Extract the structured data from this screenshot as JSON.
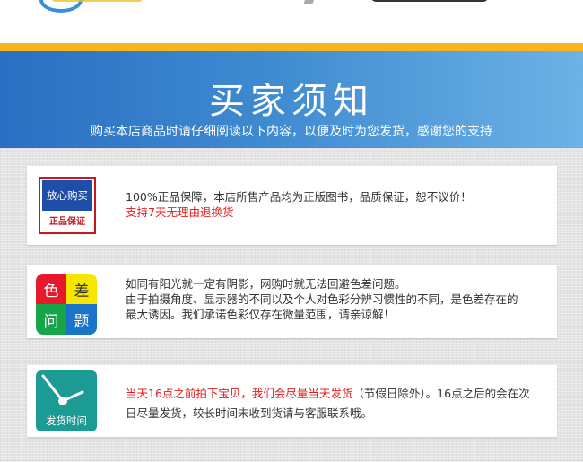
{
  "colors": {
    "accent_orange": "#f6b51c",
    "banner_left": "#2a6fc2",
    "banner_right": "#6cb2e6",
    "red_text": "#e02020",
    "card_bg": "#ffffff",
    "texture_bg": "#e3e3e3"
  },
  "banner": {
    "title": "买家须知",
    "subtitle": "购买本店商品时请仔细阅读以下内容，以便及时为您发货，感谢您的支持"
  },
  "cards": [
    {
      "icon": "guarantee-badge-icon",
      "icon_top_label": "放心购买",
      "icon_bottom_label": "正品保证",
      "line1": "100%正品保障，本店所售产品均为正版图书，品质保证，恕不议价！",
      "line2": "支持7天无理由退换货"
    },
    {
      "icon": "color-difference-icon",
      "icon_chars": [
        "色",
        "差",
        "问",
        "题"
      ],
      "line1": "如同有阳光就一定有阴影，网购时就无法回避色差问题。",
      "line2": "由于拍摄角度、显示器的不同以及个人对色彩分辨习惯性的不同，是色差存在的",
      "line3": "最大诱因。我们承诺色彩仅存在微量范围，请亲谅解！"
    },
    {
      "icon": "clock-icon",
      "icon_label": "发货时间",
      "red_part": "当天16点之前拍下宝贝，我们会尽量当天发货",
      "rest_part": "（节假日除外）。16点之后的会在次",
      "line2": "日尽量发货，较长时间未收到货请与客服联系哦。"
    }
  ]
}
